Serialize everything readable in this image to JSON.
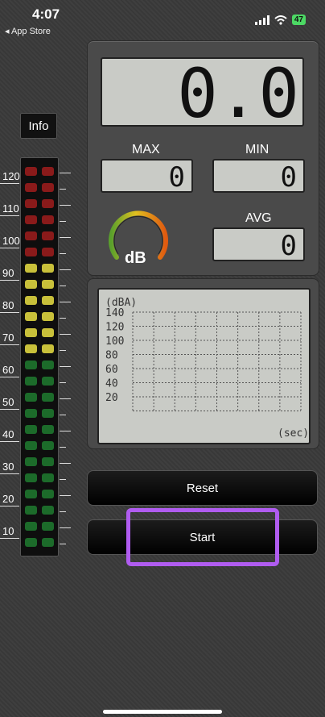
{
  "status_bar": {
    "time": "4:07",
    "back_label": "◂ App Store",
    "battery": "47"
  },
  "info_button": "Info",
  "scale_labels": [
    "120",
    "110",
    "100",
    "90",
    "80",
    "70",
    "60",
    "50",
    "40",
    "30",
    "20",
    "10"
  ],
  "display": {
    "main": "0.0",
    "max_label": "MAX",
    "max_value": "0",
    "min_label": "MIN",
    "min_value": "0",
    "avg_label": "AVG",
    "avg_value": "0",
    "gauge_label": "dB"
  },
  "chart": {
    "unit_top": "(dBA)",
    "y_labels": [
      "140",
      "120",
      "100",
      "80",
      "60",
      "40",
      "20"
    ],
    "unit_bottom": "(sec)"
  },
  "buttons": {
    "reset": "Reset",
    "start": "Start"
  },
  "colors": {
    "led_red": "#8a1a1a",
    "led_yellow": "#c8c03a",
    "led_green": "#1c6b2a",
    "highlight": "#b05cf0"
  }
}
